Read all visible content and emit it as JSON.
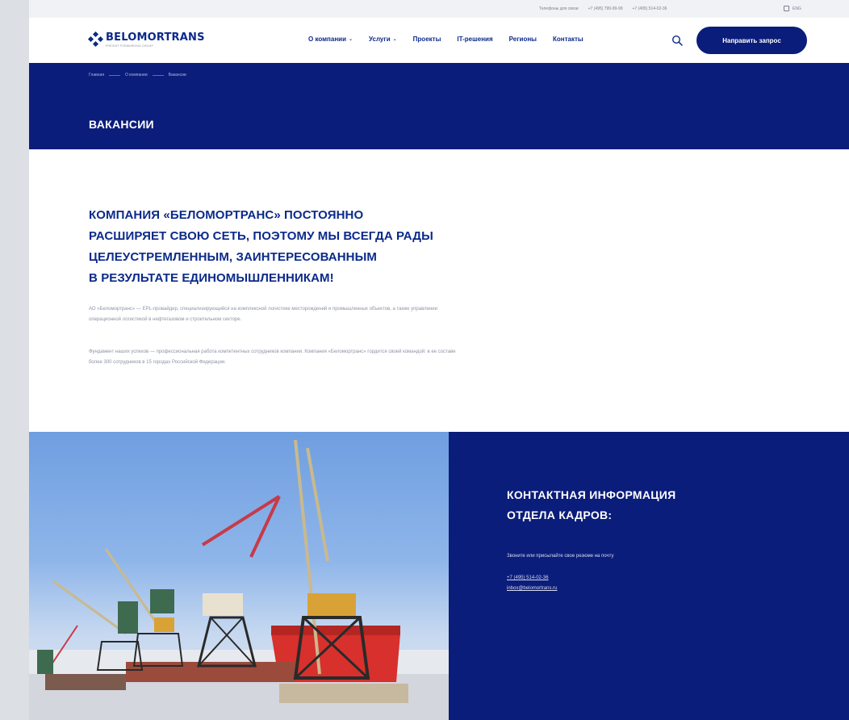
{
  "topbar": {
    "phones_label": "Телефоны для связи",
    "phone_1": "+7 (495) 799-99-99",
    "phone_2": "+7 (495) 514-02-36",
    "language": "ENG"
  },
  "header": {
    "logo_name": "BELOMORTRANS",
    "logo_tagline": "FREIGHT FORWARDING GROUP",
    "nav": [
      {
        "label": "О компании"
      },
      {
        "label": "Услуги"
      },
      {
        "label": "Проекты"
      },
      {
        "label": "IT-решения"
      },
      {
        "label": "Регионы"
      },
      {
        "label": "Контакты"
      }
    ],
    "cta_label": "Направить запрос"
  },
  "hero": {
    "breadcrumb": [
      "Главная",
      "О компании",
      "Вакансии"
    ],
    "title": "ВАКАНСИИ"
  },
  "main": {
    "headline_lines": [
      "КОМПАНИЯ «БЕЛОМОРТРАНС» ПОСТОЯННО",
      "РАСШИРЯЕТ СВОЮ СЕТЬ, ПОЭТОМУ МЫ ВСЕГДА РАДЫ",
      "ЦЕЛЕУСТРЕМЛЕННЫМ, ЗАИНТЕРЕСОВАННЫМ",
      "В РЕЗУЛЬТАТЕ ЕДИНОМЫШЛЕННИКАМ!"
    ],
    "paragraph_1": "АО «Беломортранс» — EPL-провайдер, специализирующийся на комплексной логистике месторождений и промышленных объектов, а также управлении операционной логистикой в нефтегазовом и строительном секторе.",
    "paragraph_2": "Фундамент наших успехов — профессиональная работа компетентных сотрудников компании. Компания «Беломортранс» гордится своей командой: в ее составе более 300 сотрудников в 15 городах Российской Федерации."
  },
  "contact": {
    "title_lines": [
      "КОНТАКТНАЯ ИНФОРМАЦИЯ",
      "ОТДЕЛА КАДРОВ:"
    ],
    "note": "Звоните или присылайте свое резюме на почту",
    "phone": "+7 (495) 514-02-36",
    "email": "inbox@belomortrans.ru"
  },
  "colors": {
    "brand_blue": "#0b1d7a",
    "text_blue": "#0b2a8a"
  }
}
